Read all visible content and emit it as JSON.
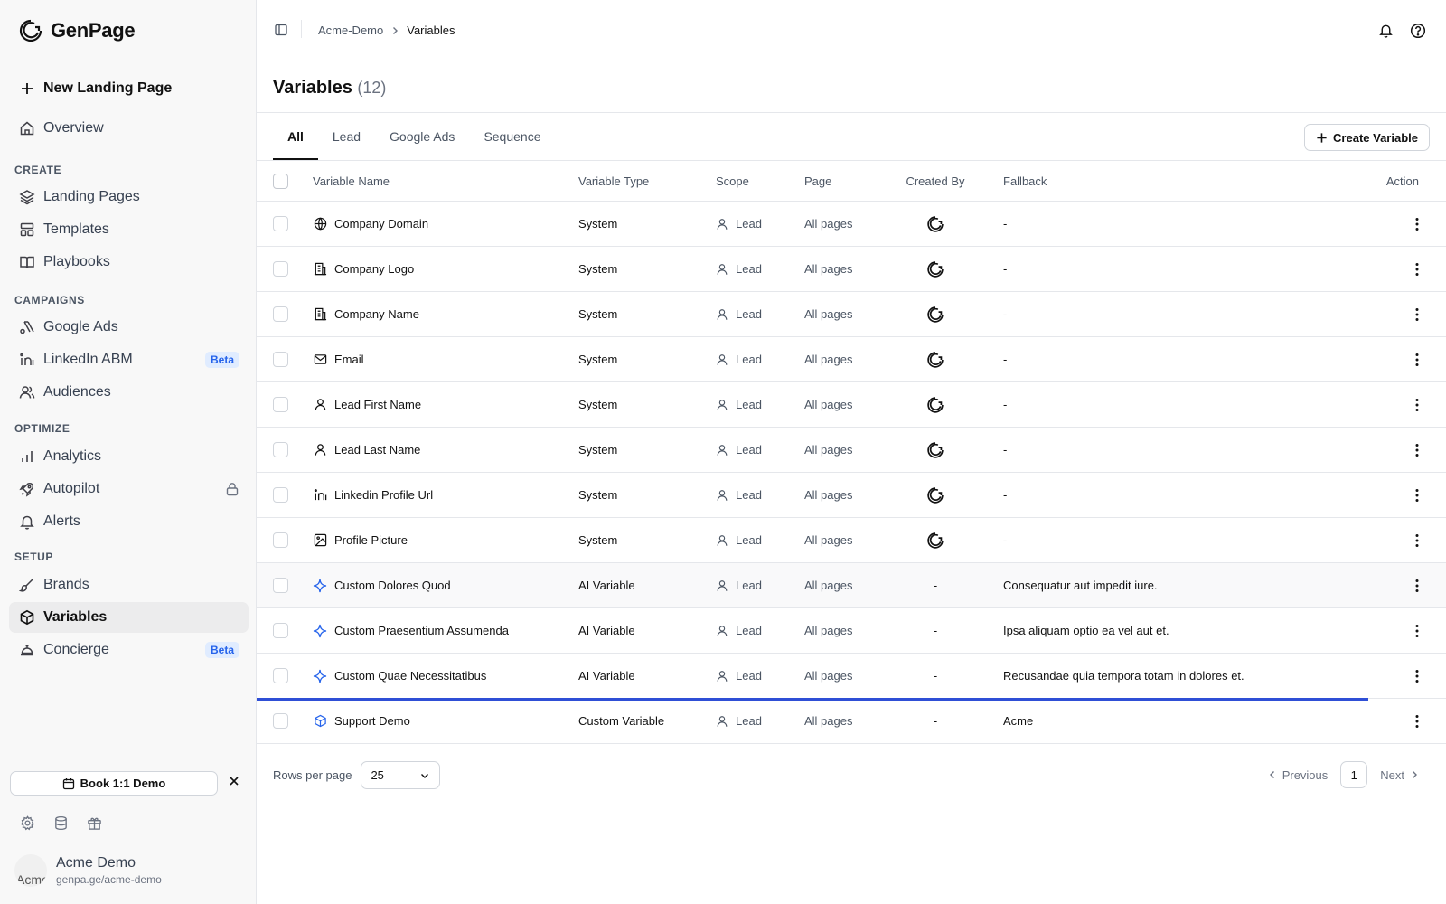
{
  "app": {
    "name": "GenPage"
  },
  "sidebar": {
    "new_page": "New Landing Page",
    "overview": "Overview",
    "sections": {
      "create": "CREATE",
      "campaigns": "CAMPAIGNS",
      "optimize": "OPTIMIZE",
      "setup": "SETUP"
    },
    "items": {
      "landing_pages": "Landing Pages",
      "templates": "Templates",
      "playbooks": "Playbooks",
      "google_ads": "Google Ads",
      "linkedin_abm": "LinkedIn ABM",
      "audiences": "Audiences",
      "analytics": "Analytics",
      "autopilot": "Autopilot",
      "alerts": "Alerts",
      "brands": "Brands",
      "variables": "Variables",
      "concierge": "Concierge"
    },
    "beta_label": "Beta",
    "demo_button": "Book 1:1 Demo",
    "profile": {
      "name": "Acme Demo",
      "url": "genpa.ge/acme-demo",
      "avatar_alt": "Acme"
    }
  },
  "topbar": {
    "breadcrumb": [
      "Acme-Demo",
      "Variables"
    ]
  },
  "page": {
    "title": "Variables",
    "count": "(12)"
  },
  "tabs": [
    "All",
    "Lead",
    "Google Ads",
    "Sequence"
  ],
  "active_tab": "All",
  "create_button": "Create Variable",
  "table": {
    "headers": {
      "name": "Variable Name",
      "type": "Variable Type",
      "scope": "Scope",
      "page": "Page",
      "created_by": "Created By",
      "fallback": "Fallback",
      "action": "Action"
    },
    "rows": [
      {
        "icon": "globe-icon",
        "name": "Company Domain",
        "type": "System",
        "scope": "Lead",
        "page": "All pages",
        "created_by": "genpage-logo",
        "fallback": "-"
      },
      {
        "icon": "building-icon",
        "name": "Company Logo",
        "type": "System",
        "scope": "Lead",
        "page": "All pages",
        "created_by": "genpage-logo",
        "fallback": "-"
      },
      {
        "icon": "building-icon",
        "name": "Company Name",
        "type": "System",
        "scope": "Lead",
        "page": "All pages",
        "created_by": "genpage-logo",
        "fallback": "-"
      },
      {
        "icon": "mail-icon",
        "name": "Email",
        "type": "System",
        "scope": "Lead",
        "page": "All pages",
        "created_by": "genpage-logo",
        "fallback": "-"
      },
      {
        "icon": "user-icon",
        "name": "Lead First Name",
        "type": "System",
        "scope": "Lead",
        "page": "All pages",
        "created_by": "genpage-logo",
        "fallback": "-"
      },
      {
        "icon": "user-icon",
        "name": "Lead Last Name",
        "type": "System",
        "scope": "Lead",
        "page": "All pages",
        "created_by": "genpage-logo",
        "fallback": "-"
      },
      {
        "icon": "linkedin-icon",
        "name": "Linkedin Profile Url",
        "type": "System",
        "scope": "Lead",
        "page": "All pages",
        "created_by": "genpage-logo",
        "fallback": "-"
      },
      {
        "icon": "image-icon",
        "name": "Profile Picture",
        "type": "System",
        "scope": "Lead",
        "page": "All pages",
        "created_by": "genpage-logo",
        "fallback": "-"
      },
      {
        "icon": "sparkle-icon",
        "name": "Custom Dolores Quod",
        "type": "AI Variable",
        "scope": "Lead",
        "page": "All pages",
        "created_by": "-",
        "fallback": "Consequatur aut impedit iure."
      },
      {
        "icon": "sparkle-icon",
        "name": "Custom Praesentium Assumenda",
        "type": "AI Variable",
        "scope": "Lead",
        "page": "All pages",
        "created_by": "-",
        "fallback": "Ipsa aliquam optio ea vel aut et."
      },
      {
        "icon": "sparkle-icon",
        "name": "Custom Quae Necessitatibus",
        "type": "AI Variable",
        "scope": "Lead",
        "page": "All pages",
        "created_by": "-",
        "fallback": "Recusandae quia tempora totam in dolores et."
      },
      {
        "icon": "cube-icon",
        "name": "Support Demo",
        "type": "Custom Variable",
        "scope": "Lead",
        "page": "All pages",
        "created_by": "-",
        "fallback": "Acme"
      }
    ]
  },
  "pagination": {
    "rows_per_page_label": "Rows per page",
    "rows_per_page": "25",
    "previous": "Previous",
    "current_page": "1",
    "next": "Next"
  },
  "colors": {
    "accent": "#2563eb",
    "selection_line": "#2f4fd6"
  }
}
